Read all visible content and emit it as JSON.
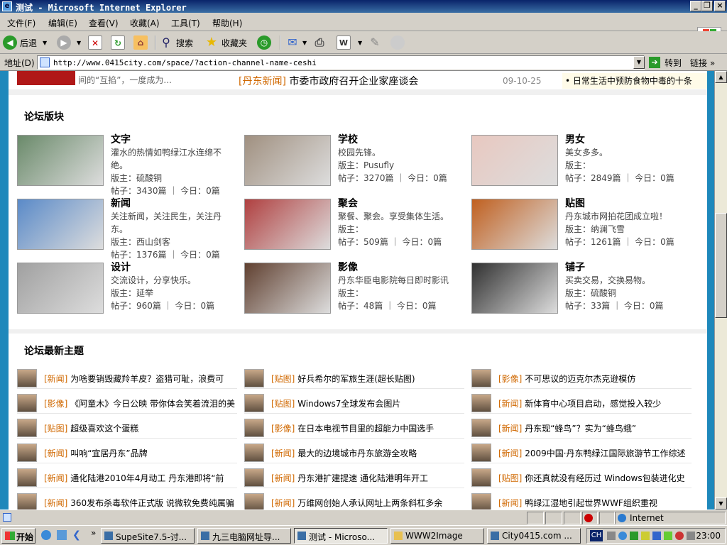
{
  "window": {
    "title": "测试 - Microsoft Internet Explorer"
  },
  "menu": [
    "文件(F)",
    "编辑(E)",
    "查看(V)",
    "收藏(A)",
    "工具(T)",
    "帮助(H)"
  ],
  "toolbar": {
    "back": "后退",
    "search": "搜索",
    "favorites": "收藏夹"
  },
  "address": {
    "label": "地址(D)",
    "url": "http://www.0415city.com/space/?action-channel-name-ceshi",
    "go": "转到",
    "links": "链接"
  },
  "top_strip": {
    "left_text": "间的“互掐”，一度成为...",
    "news_tag": "[丹东新闻]",
    "news_title": "市委市政府召开企业家座谈会",
    "news_date": "09-10-25",
    "right_text": "• 日常生活中预防食物中毒的十条"
  },
  "forums": {
    "title": "论坛版块",
    "items": [
      {
        "name": "文字",
        "desc": "灌水的热情如鸭绿江水连绵不绝。",
        "mod": "版主：硫酸铜",
        "stats": "帖子：3430篇 ｜ 今日：0篇"
      },
      {
        "name": "学校",
        "desc": "校园先锋。",
        "mod": "版主：Pusufly",
        "stats": "帖子：3270篇 ｜ 今日：0篇"
      },
      {
        "name": "男女",
        "desc": "美女多多。",
        "mod": "版主：",
        "stats": "帖子：2849篇 ｜ 今日：0篇"
      },
      {
        "name": "新闻",
        "desc": "关注新闻，关注民生，关注丹东。",
        "mod": "版主：西山剑客",
        "stats": "帖子：1376篇 ｜ 今日：0篇"
      },
      {
        "name": "聚会",
        "desc": "聚餐、聚会。享受集体生活。",
        "mod": "版主：",
        "stats": "帖子：509篇 ｜ 今日：0篇"
      },
      {
        "name": "贴图",
        "desc": "丹东城市网拍花团成立啦！",
        "mod": "版主：纳澜飞雪",
        "stats": "帖子：1261篇 ｜ 今日：0篇"
      },
      {
        "name": "设计",
        "desc": "交流设计，分享快乐。",
        "mod": "版主：延举",
        "stats": "帖子：960篇 ｜ 今日：0篇"
      },
      {
        "name": "影像",
        "desc": "丹东华臣电影院每日即时影讯",
        "mod": "版主：",
        "stats": "帖子：48篇 ｜ 今日：0篇"
      },
      {
        "name": "铺子",
        "desc": "买卖交易，交换易物。",
        "mod": "版主：硫酸铜",
        "stats": "帖子：33篇 ｜ 今日：0篇"
      }
    ]
  },
  "latest": {
    "title": "论坛最新主题",
    "topics": [
      {
        "tag": "[新闻]",
        "text": "为啥要销毁藏羚羊皮？盗猎可耻，浪费可"
      },
      {
        "tag": "[贴图]",
        "text": "好兵希尔的军旅生涯(超长贴图)"
      },
      {
        "tag": "[影像]",
        "text": "不可思议的迈克尔杰克逊模仿"
      },
      {
        "tag": "[影像]",
        "text": "《阿童木》今日公映 带你体会笑着流泪的美"
      },
      {
        "tag": "[贴图]",
        "text": "Windows7全球发布会图片"
      },
      {
        "tag": "[新闻]",
        "text": "新体育中心项目启动，感觉投入较少"
      },
      {
        "tag": "[贴图]",
        "text": "超级喜欢这个蛋糕"
      },
      {
        "tag": "[影像]",
        "text": "在日本电视节目里的超能力中国选手"
      },
      {
        "tag": "[新闻]",
        "text": "丹东现“蜂鸟”？实为“蜂鸟蛾”"
      },
      {
        "tag": "[新闻]",
        "text": "叫响“宜居丹东”品牌"
      },
      {
        "tag": "[新闻]",
        "text": "最大的边境城市丹东旅游全攻略"
      },
      {
        "tag": "[新闻]",
        "text": "2009中国·丹东鸭绿江国际旅游节工作综述"
      },
      {
        "tag": "[新闻]",
        "text": "通化陆港2010年4月动工 丹东港即将“前"
      },
      {
        "tag": "[新闻]",
        "text": "丹东港扩建提速 通化陆港明年开工"
      },
      {
        "tag": "[贴图]",
        "text": "你还真就没有经历过 Windows包装进化史"
      },
      {
        "tag": "[新闻]",
        "text": "360发布杀毒软件正式版 说微软免费纯属骗"
      },
      {
        "tag": "[新闻]",
        "text": "万维网创始人承认网址上两条斜杠多余"
      },
      {
        "tag": "[新闻]",
        "text": "鸭绿江湿地引起世界WWF组织重视"
      }
    ]
  },
  "status": {
    "zone": "Internet"
  },
  "taskbar": {
    "start": "开始",
    "tasks": [
      "SupeSite7.5-讨...",
      "九三电脑网址导...",
      "测试 - Microso...",
      "WWW2Image",
      "City0415.com ..."
    ],
    "lang": "CH",
    "clock": "23:00"
  }
}
